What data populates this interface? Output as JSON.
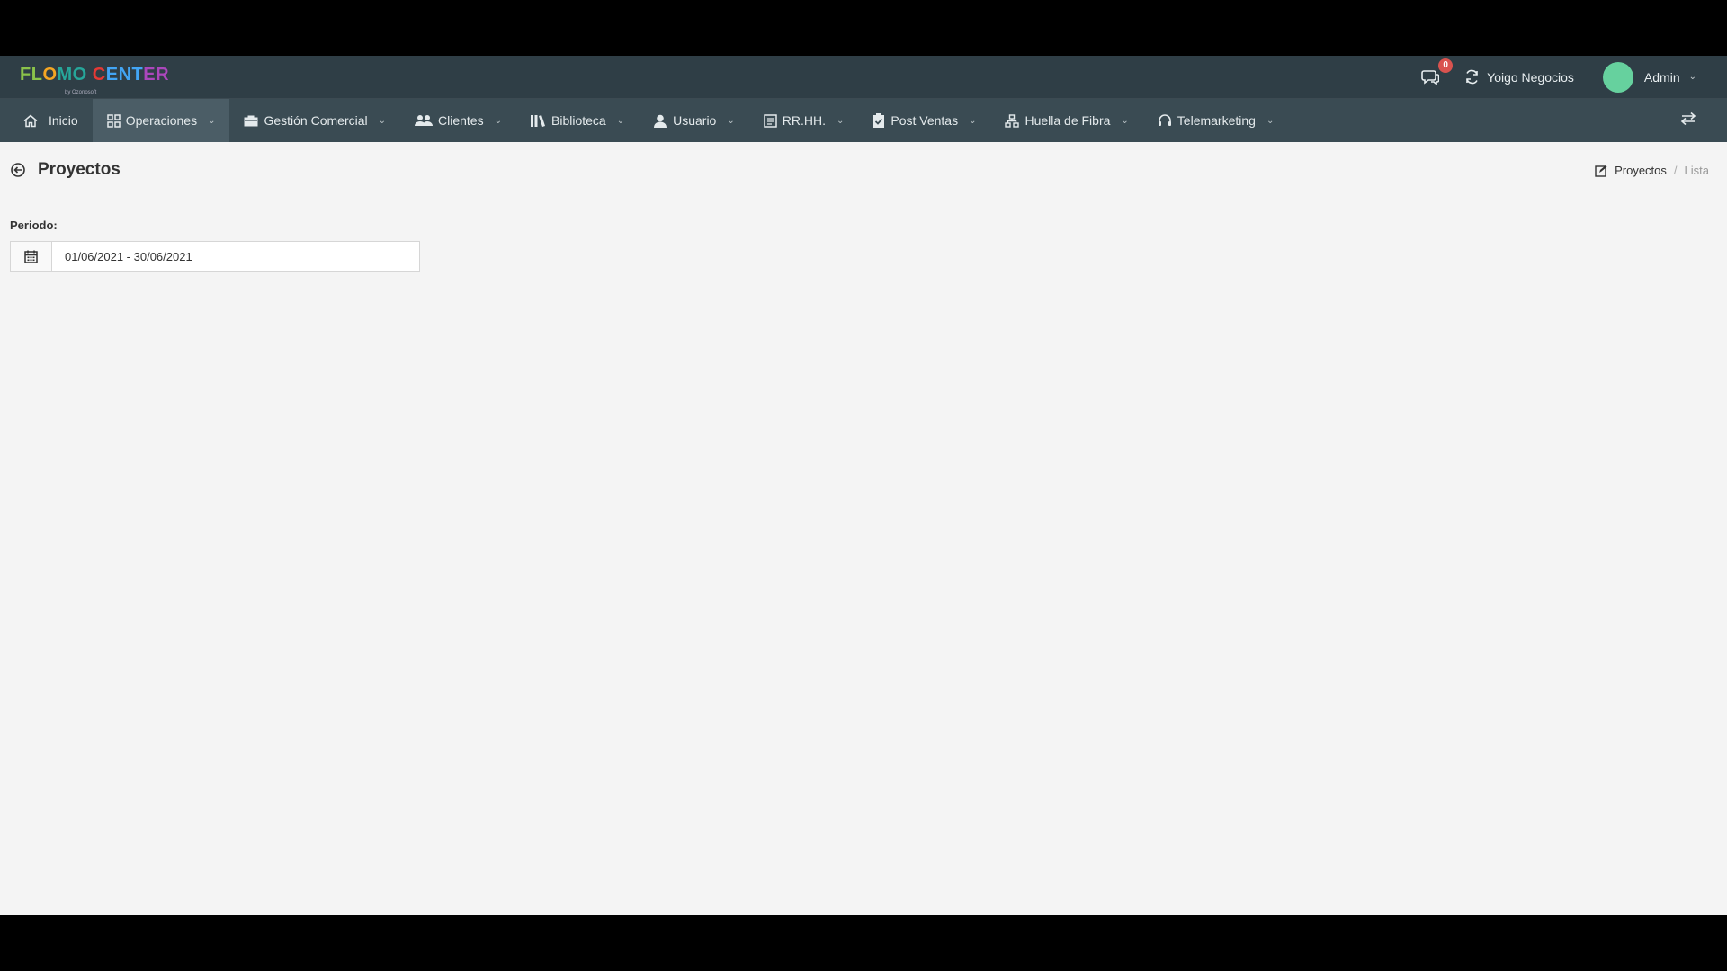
{
  "app": {
    "logo_text": [
      "FL",
      "O",
      "MO ",
      "C",
      "ENT",
      "ER"
    ],
    "logo_sub": "by Ozonosoft"
  },
  "topbar": {
    "notifications_count": "0",
    "company_name": "Yoigo Negocios",
    "user_name": "Admin"
  },
  "nav": {
    "items": [
      {
        "label": "Inicio",
        "icon": "home-icon",
        "dropdown": false,
        "active": false
      },
      {
        "label": "Operaciones",
        "icon": "grid-icon",
        "dropdown": true,
        "active": true
      },
      {
        "label": "Gestión Comercial",
        "icon": "briefcase-icon",
        "dropdown": true,
        "active": false
      },
      {
        "label": "Clientes",
        "icon": "users-icon",
        "dropdown": true,
        "active": false
      },
      {
        "label": "Biblioteca",
        "icon": "library-icon",
        "dropdown": true,
        "active": false
      },
      {
        "label": "Usuario",
        "icon": "user-icon",
        "dropdown": true,
        "active": false
      },
      {
        "label": "RR.HH.",
        "icon": "id-card-icon",
        "dropdown": true,
        "active": false
      },
      {
        "label": "Post Ventas",
        "icon": "clipboard-check-icon",
        "dropdown": true,
        "active": false
      },
      {
        "label": "Huella de Fibra",
        "icon": "sitemap-icon",
        "dropdown": true,
        "active": false
      },
      {
        "label": "Telemarketing",
        "icon": "headset-icon",
        "dropdown": true,
        "active": false
      }
    ]
  },
  "page": {
    "title": "Proyectos",
    "breadcrumb": {
      "current": "Proyectos",
      "sub": "Lista",
      "separator": "/"
    }
  },
  "filter": {
    "label": "Periodo:",
    "date_range": "01/06/2021 - 30/06/2021"
  },
  "colors": {
    "topbar_bg": "#2f3e46",
    "navbar_bg": "#3a4b53",
    "active_nav_bg": "#4b5d66",
    "page_bg": "#f4f4f4",
    "avatar": "#66d19e",
    "badge": "#d9534f"
  }
}
